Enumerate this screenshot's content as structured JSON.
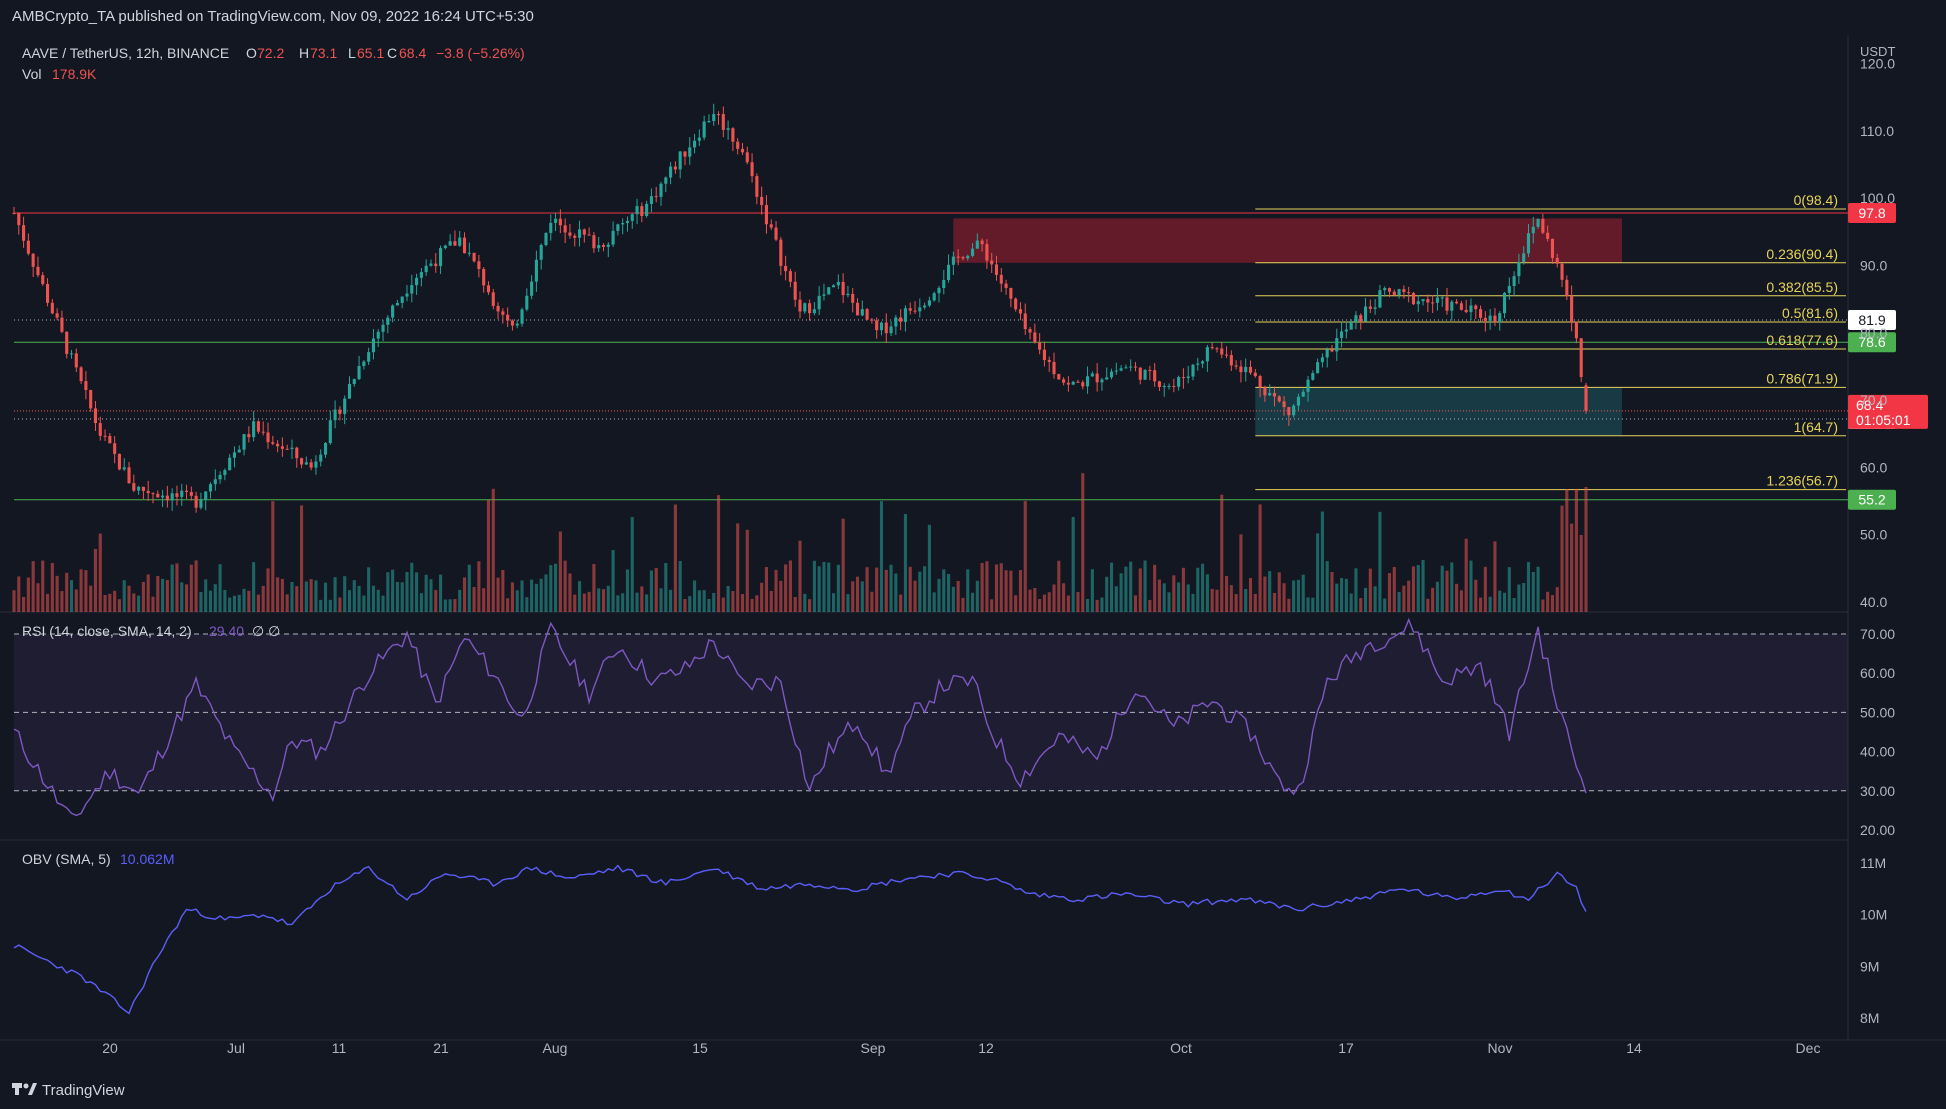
{
  "header": {
    "publisher": "AMBCrypto_TA published on TradingView.com, Nov 09, 2022 16:24 UTC+5:30",
    "symbol": "AAVE / TetherUS, 12h, BINANCE",
    "ohlc": [
      {
        "k": "O",
        "v": "72.2"
      },
      {
        "k": "H",
        "v": "73.1"
      },
      {
        "k": "L",
        "v": "65.1"
      },
      {
        "k": "C",
        "v": "68.4"
      }
    ],
    "change": "−3.8 (−5.26%)",
    "vol_label": "Vol",
    "vol_value": "178.9K"
  },
  "footer": {
    "brand": "TradingView"
  },
  "colors": {
    "up": "#26a69a",
    "down": "#ef5350",
    "fib": "#e6d35a",
    "rsi": "#7e57c2",
    "obv": "#5b5ef7",
    "bg": "#131722"
  },
  "chart_data": [
    {
      "type": "candlestick",
      "title": "AAVE / TetherUS, 12h, BINANCE",
      "ylabel": "USDT",
      "ylim": [
        38,
        122
      ],
      "yticks": [
        "40.0",
        "50.0",
        "60.0",
        "70.0",
        "80.0",
        "90.0",
        "100.0",
        "110.0",
        "120.0"
      ],
      "x_tick_labels": [
        "20",
        "Jul",
        "11",
        "21",
        "Aug",
        "15",
        "Sep",
        "12",
        "Oct",
        "17",
        "Nov",
        "14",
        "Dec"
      ],
      "anchors": [
        {
          "i": 0,
          "c": 97.8
        },
        {
          "i": 18,
          "c": 65
        },
        {
          "i": 25,
          "c": 57
        },
        {
          "i": 38,
          "c": 55
        },
        {
          "i": 50,
          "c": 66
        },
        {
          "i": 62,
          "c": 60
        },
        {
          "i": 74,
          "c": 78
        },
        {
          "i": 83,
          "c": 88
        },
        {
          "i": 93,
          "c": 94
        },
        {
          "i": 104,
          "c": 80
        },
        {
          "i": 112,
          "c": 97
        },
        {
          "i": 122,
          "c": 93
        },
        {
          "i": 132,
          "c": 99
        },
        {
          "i": 146,
          "c": 113
        },
        {
          "i": 152,
          "c": 107
        },
        {
          "i": 164,
          "c": 83
        },
        {
          "i": 172,
          "c": 87
        },
        {
          "i": 180,
          "c": 80
        },
        {
          "i": 190,
          "c": 85
        },
        {
          "i": 198,
          "c": 92
        },
        {
          "i": 202,
          "c": 93
        },
        {
          "i": 212,
          "c": 79
        },
        {
          "i": 220,
          "c": 72
        },
        {
          "i": 232,
          "c": 75
        },
        {
          "i": 242,
          "c": 72
        },
        {
          "i": 250,
          "c": 78
        },
        {
          "i": 258,
          "c": 74
        },
        {
          "i": 266,
          "c": 68
        },
        {
          "i": 276,
          "c": 79
        },
        {
          "i": 286,
          "c": 86
        },
        {
          "i": 300,
          "c": 84
        },
        {
          "i": 309,
          "c": 82
        },
        {
          "i": 314,
          "c": 91
        },
        {
          "i": 318,
          "c": 97
        },
        {
          "i": 322,
          "c": 90
        },
        {
          "i": 326,
          "c": 80
        },
        {
          "i": 328,
          "c": 68.4
        }
      ],
      "horizontal_levels": [
        {
          "name": "resistance",
          "price": 97.8,
          "label": "97.8",
          "color": "#f23645"
        },
        {
          "name": "support-78",
          "price": 78.6,
          "label": "78.6",
          "color": "#4caf50"
        },
        {
          "name": "support-55",
          "price": 55.2,
          "label": "55.2",
          "color": "#4caf50"
        }
      ],
      "dotted_levels": [
        {
          "price": 81.9,
          "label": "81.9"
        },
        {
          "price": 67.2,
          "label": "67.2"
        }
      ],
      "fib_levels": [
        {
          "label": "0(98.4)",
          "price": 98.4
        },
        {
          "label": "0.236(90.4)",
          "price": 90.4
        },
        {
          "label": "0.382(85.5)",
          "price": 85.5
        },
        {
          "label": "0.5(81.6)",
          "price": 81.6
        },
        {
          "label": "0.618(77.6)",
          "price": 77.6
        },
        {
          "label": "0.786(71.9)",
          "price": 71.9
        },
        {
          "label": "1(64.7)",
          "price": 64.7
        },
        {
          "label": "1.236(56.7)",
          "price": 56.7
        }
      ],
      "zones": [
        {
          "name": "supply-zone",
          "y_from": 90.4,
          "y_to": 97.0,
          "x_from": "Sep 12",
          "x_to": "Nov 09",
          "color": "#7f1d2e"
        },
        {
          "name": "demand-zone",
          "y_from": 64.7,
          "y_to": 71.9,
          "x_from": "Oct 14",
          "x_to": "Nov 09",
          "color": "#1b4a52"
        }
      ],
      "current_price": {
        "value": "68.4",
        "countdown": "01:05:01"
      }
    },
    {
      "type": "line",
      "title": "RSI (14, close, SMA, 14, 2)",
      "value_label": "29.40",
      "extra": "∅ ∅",
      "ylim": [
        18,
        73
      ],
      "yticks": [
        "20.00",
        "30.00",
        "40.00",
        "50.00",
        "60.00",
        "70.00"
      ],
      "bands": [
        30,
        50,
        70
      ],
      "anchors": [
        {
          "i": 0,
          "v": 45
        },
        {
          "i": 12,
          "v": 22
        },
        {
          "i": 20,
          "v": 35
        },
        {
          "i": 26,
          "v": 29
        },
        {
          "i": 38,
          "v": 57
        },
        {
          "i": 46,
          "v": 40
        },
        {
          "i": 54,
          "v": 29
        },
        {
          "i": 58,
          "v": 43
        },
        {
          "i": 64,
          "v": 40
        },
        {
          "i": 74,
          "v": 60
        },
        {
          "i": 82,
          "v": 70
        },
        {
          "i": 88,
          "v": 52
        },
        {
          "i": 94,
          "v": 69
        },
        {
          "i": 100,
          "v": 60
        },
        {
          "i": 106,
          "v": 48
        },
        {
          "i": 112,
          "v": 71
        },
        {
          "i": 120,
          "v": 55
        },
        {
          "i": 126,
          "v": 67
        },
        {
          "i": 134,
          "v": 58
        },
        {
          "i": 140,
          "v": 61
        },
        {
          "i": 146,
          "v": 68
        },
        {
          "i": 152,
          "v": 57
        },
        {
          "i": 160,
          "v": 58
        },
        {
          "i": 166,
          "v": 30
        },
        {
          "i": 170,
          "v": 40
        },
        {
          "i": 176,
          "v": 48
        },
        {
          "i": 182,
          "v": 34
        },
        {
          "i": 188,
          "v": 50
        },
        {
          "i": 194,
          "v": 57
        },
        {
          "i": 200,
          "v": 58
        },
        {
          "i": 204,
          "v": 45
        },
        {
          "i": 210,
          "v": 33
        },
        {
          "i": 218,
          "v": 44
        },
        {
          "i": 226,
          "v": 38
        },
        {
          "i": 234,
          "v": 57
        },
        {
          "i": 242,
          "v": 46
        },
        {
          "i": 250,
          "v": 53
        },
        {
          "i": 258,
          "v": 45
        },
        {
          "i": 264,
          "v": 32
        },
        {
          "i": 268,
          "v": 30
        },
        {
          "i": 274,
          "v": 58
        },
        {
          "i": 282,
          "v": 67
        },
        {
          "i": 292,
          "v": 72
        },
        {
          "i": 298,
          "v": 58
        },
        {
          "i": 306,
          "v": 62
        },
        {
          "i": 312,
          "v": 45
        },
        {
          "i": 318,
          "v": 71
        },
        {
          "i": 322,
          "v": 52
        },
        {
          "i": 326,
          "v": 37
        },
        {
          "i": 328,
          "v": 29.4
        }
      ]
    },
    {
      "type": "line",
      "title": "OBV (SMA, 5)",
      "value_label": "10.062M",
      "ylim": [
        7.9,
        11.2
      ],
      "yticks": [
        "8M",
        "9M",
        "10M",
        "11M"
      ],
      "anchors": [
        {
          "i": 0,
          "v": 9.4
        },
        {
          "i": 14,
          "v": 8.8
        },
        {
          "i": 20,
          "v": 8.4
        },
        {
          "i": 24,
          "v": 8.1
        },
        {
          "i": 30,
          "v": 9.2
        },
        {
          "i": 36,
          "v": 10.1
        },
        {
          "i": 44,
          "v": 9.9
        },
        {
          "i": 52,
          "v": 10.0
        },
        {
          "i": 58,
          "v": 9.8
        },
        {
          "i": 66,
          "v": 10.5
        },
        {
          "i": 74,
          "v": 10.9
        },
        {
          "i": 82,
          "v": 10.3
        },
        {
          "i": 90,
          "v": 10.8
        },
        {
          "i": 100,
          "v": 10.6
        },
        {
          "i": 108,
          "v": 10.9
        },
        {
          "i": 116,
          "v": 10.7
        },
        {
          "i": 126,
          "v": 10.9
        },
        {
          "i": 136,
          "v": 10.6
        },
        {
          "i": 146,
          "v": 10.9
        },
        {
          "i": 156,
          "v": 10.5
        },
        {
          "i": 166,
          "v": 10.6
        },
        {
          "i": 176,
          "v": 10.5
        },
        {
          "i": 186,
          "v": 10.7
        },
        {
          "i": 196,
          "v": 10.8
        },
        {
          "i": 204,
          "v": 10.7
        },
        {
          "i": 212,
          "v": 10.4
        },
        {
          "i": 222,
          "v": 10.3
        },
        {
          "i": 232,
          "v": 10.4
        },
        {
          "i": 244,
          "v": 10.2
        },
        {
          "i": 256,
          "v": 10.3
        },
        {
          "i": 268,
          "v": 10.1
        },
        {
          "i": 280,
          "v": 10.3
        },
        {
          "i": 290,
          "v": 10.5
        },
        {
          "i": 300,
          "v": 10.3
        },
        {
          "i": 310,
          "v": 10.5
        },
        {
          "i": 316,
          "v": 10.3
        },
        {
          "i": 322,
          "v": 10.8
        },
        {
          "i": 326,
          "v": 10.5
        },
        {
          "i": 328,
          "v": 10.06
        }
      ]
    }
  ]
}
